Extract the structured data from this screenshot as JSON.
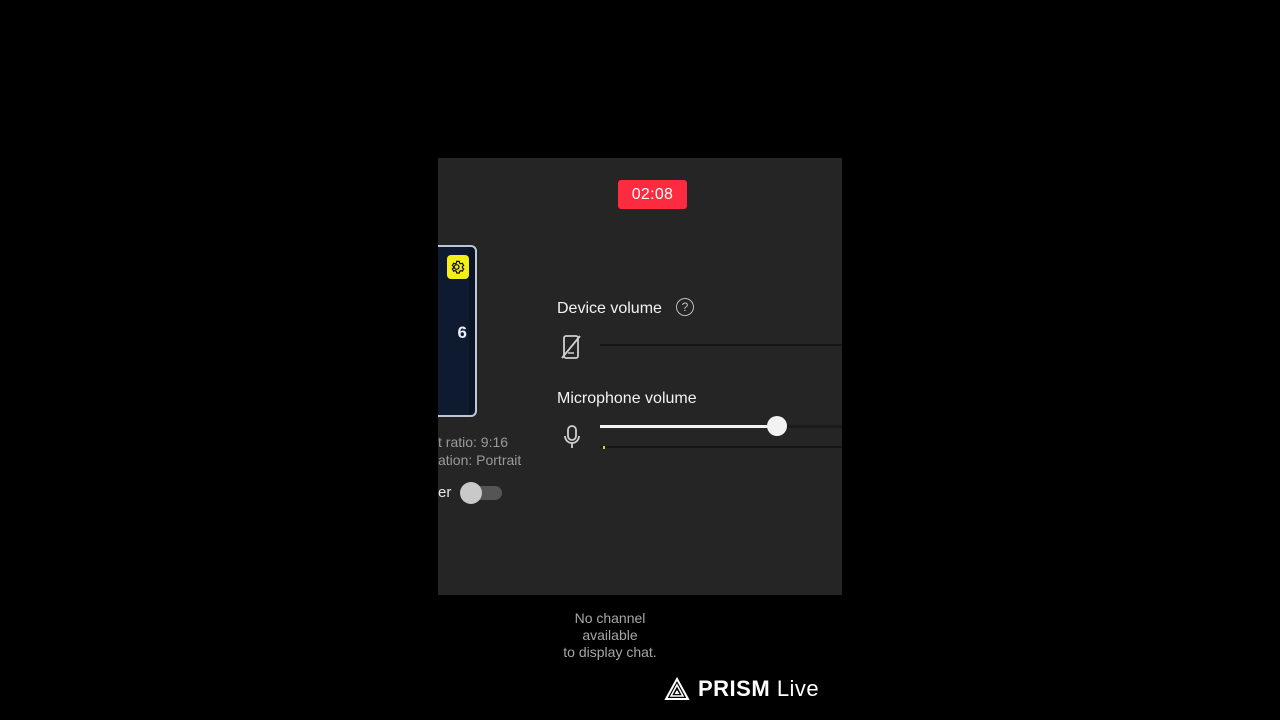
{
  "timer": {
    "text": "02:08",
    "color": "#fc2b3f"
  },
  "preview": {
    "digit": "6",
    "gear_badge_color": "#f4ef1a",
    "aspect_ratio_text": "t ratio: 9:16",
    "orientation_text": "ation: Portrait"
  },
  "toggle": {
    "label": "er",
    "on": false
  },
  "device_volume": {
    "title": "Device volume",
    "help_symbol": "?",
    "icon": "phone-muted-icon"
  },
  "microphone_volume": {
    "title": "Microphone volume",
    "icon": "microphone-icon",
    "level": 0.73
  },
  "chat": {
    "message_line1": "No channel",
    "message_line2": "available",
    "message_line3": "to display chat."
  },
  "brand": {
    "name_bold": "PRISM",
    "name_light": "Live",
    "icon": "prism-logo-icon"
  }
}
